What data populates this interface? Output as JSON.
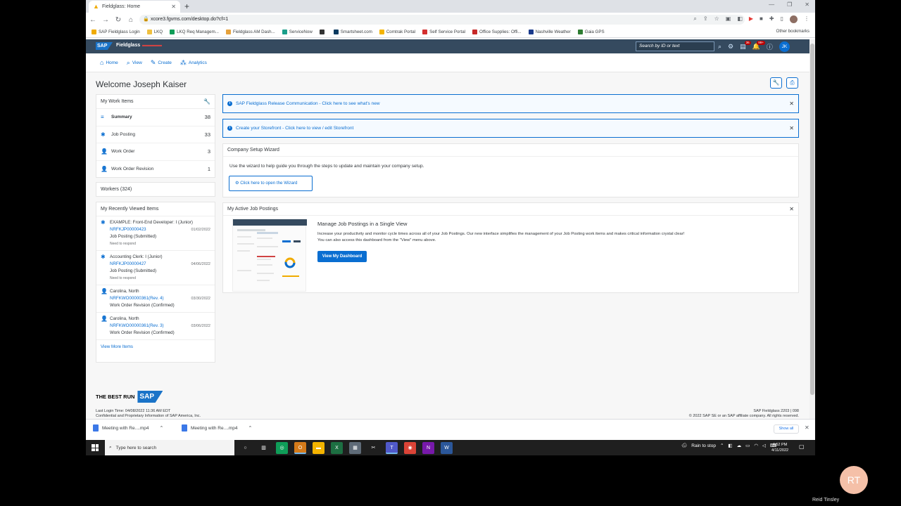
{
  "browser": {
    "tab_title": "Fieldglass: Home",
    "url": "xcore3.fgvms.com/desktop.do?cf=1",
    "bookmarks": [
      {
        "label": "SAP Fieldglass Login",
        "color": "#f0ab00"
      },
      {
        "label": "LKQ",
        "color": "#f0c040"
      },
      {
        "label": "LKQ Req Managem...",
        "color": "#0f9d58"
      },
      {
        "label": "Fieldglass AM Dash...",
        "color": "#e6a23c"
      },
      {
        "label": "ServiceNow",
        "color": "#1a9e8a"
      },
      {
        "label": "",
        "color": "#333333"
      },
      {
        "label": "Smartsheet.com",
        "color": "#0b3b60"
      },
      {
        "label": "Comtrak Portal",
        "color": "#f4b400"
      },
      {
        "label": "Self Service Portal",
        "color": "#d32f2f"
      },
      {
        "label": "Office Supplies: Offi...",
        "color": "#c62828"
      },
      {
        "label": "Nashville Weather",
        "color": "#1a3a8c"
      },
      {
        "label": "Gaia GPS",
        "color": "#2e7d32"
      }
    ],
    "other_bookmarks": "Other bookmarks"
  },
  "shell": {
    "logo": "SAP",
    "product": "Fieldglass",
    "search_placeholder": "Search by ID or text",
    "badge_tasks": "36",
    "badge_notifications": "99+",
    "avatar_initials": "JK"
  },
  "nav": {
    "home": "Home",
    "view": "View",
    "create": "Create",
    "analytics": "Analytics"
  },
  "welcome": "Welcome Joseph Kaiser",
  "work_items": {
    "title": "My Work Items",
    "rows": [
      {
        "label": "Summary",
        "count": "38"
      },
      {
        "label": "Job Posting",
        "count": "33"
      },
      {
        "label": "Work Order",
        "count": "3"
      },
      {
        "label": "Work Order Revision",
        "count": "1"
      }
    ]
  },
  "workers": "Workers (324)",
  "recent": {
    "title": "My Recently Viewed Items",
    "items": [
      {
        "title": "EXAMPLE: Front-End Developer: I (Junior)",
        "link": "NRFKJP00000423",
        "date": "01/02/2022",
        "status": "Job Posting (Submitted)",
        "note": "Need to respond"
      },
      {
        "title": "Accounting Clerk: I (Junior)",
        "link": "NRFKJP00000427",
        "date": "04/06/2022",
        "status": "Job Posting (Submitted)",
        "note": "Need to respond"
      },
      {
        "title": "Carolina, North",
        "link": "NRFKWO00000361(Rev. 4)",
        "date": "03/30/2022",
        "status": "Work Order Revision (Confirmed)",
        "note": ""
      },
      {
        "title": "Carolina, North",
        "link": "NRFKWO00000361(Rev. 3)",
        "date": "03/06/2022",
        "status": "Work Order Revision (Confirmed)",
        "note": ""
      }
    ],
    "view_more": "View More Items"
  },
  "messages": {
    "release": "SAP Fieldglass Release Communication - Click here to see what's new",
    "storefront": "Create your Storefront - Click here to view / edit Storefront"
  },
  "wizard": {
    "title": "Company Setup Wizard",
    "text": "Use the wizard to help guide you through the steps to update and maintain your company setup.",
    "button": "Click here to open the Wizard"
  },
  "active_jobs": {
    "title": "My Active Job Postings",
    "heading": "Manage Job Postings in a Single View",
    "line1": "Increase your productivity and monitor cycle times across all of your Job Postings. Our new interface simplifies the management of your Job Posting work items and makes critical information crystal clear!",
    "line2": "You can also access this dashboard from the \"View\" menu above.",
    "button": "View My Dashboard"
  },
  "footer": {
    "brand": "THE BEST RUN",
    "brand_logo": "SAP",
    "last_login": "Last Login Time: 04/08/2022 11:36 AM EDT",
    "confidential": "Confidential and Proprietary Information of SAP America, Inc.",
    "version": "SAP Fieldglass 2203 | 098",
    "copyright": "© 2022 SAP SE or an SAP affiliate company. All rights reserved."
  },
  "downloads": {
    "items": [
      "Meeting with Re....mp4",
      "Meeting with Re....mp4"
    ],
    "show_all": "Show all"
  },
  "taskbar": {
    "search": "Type here to search",
    "weather": "Rain to stop",
    "time": "4:52 PM",
    "date": "4/11/2022"
  },
  "participant": {
    "initials": "RT",
    "name": "Reid Tinsley"
  }
}
